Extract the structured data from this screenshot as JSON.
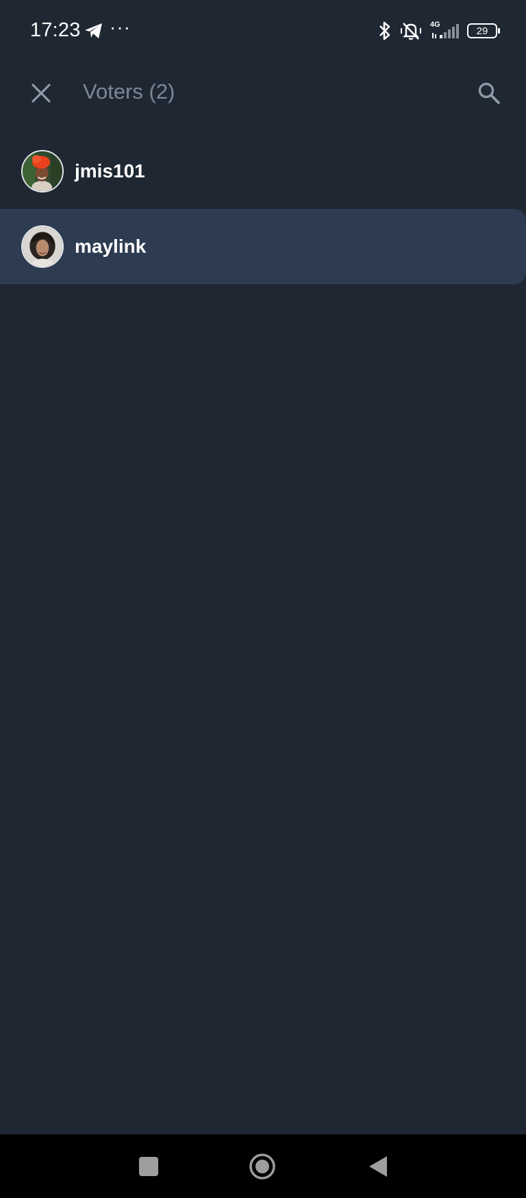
{
  "status_bar": {
    "time": "17:23",
    "more": "···",
    "network": "4G",
    "battery": "29",
    "icons": [
      "telegram-icon",
      "bluetooth-icon",
      "vibrate-mute-icon",
      "signal-icon",
      "battery-icon"
    ]
  },
  "toolbar": {
    "title": "Voters (2)",
    "close_icon": "close-icon",
    "search_icon": "search-icon"
  },
  "voters": [
    {
      "name": "jmis101",
      "avatar": "avatar-orange-headwrap",
      "selected": false
    },
    {
      "name": "maylink",
      "avatar": "avatar-curly-hair",
      "selected": true
    }
  ],
  "nav_bar": {
    "icons": [
      "recents-icon",
      "home-icon",
      "back-icon"
    ]
  },
  "colors": {
    "background": "#1f2733",
    "selected_row": "#2e3c52",
    "title_text": "#7d8896",
    "name_text": "#ffffff",
    "nav_background": "#000000"
  }
}
